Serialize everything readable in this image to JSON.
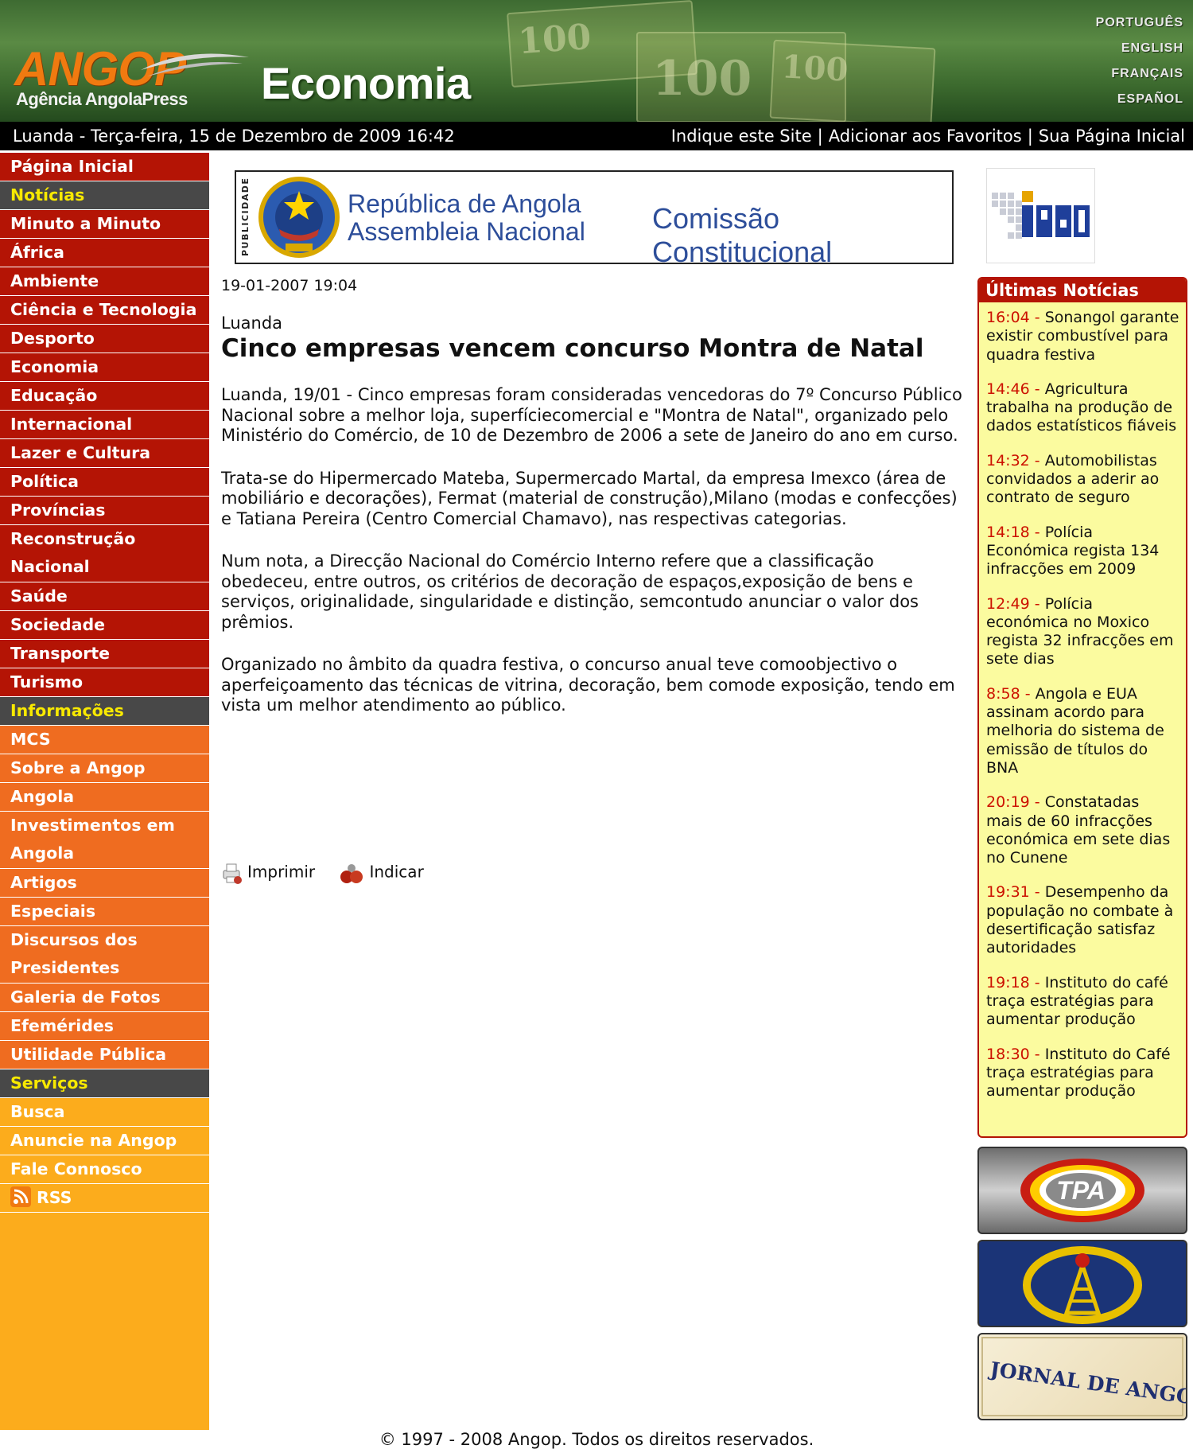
{
  "header": {
    "logo_word": "ANGOP",
    "logo_tagline": "Agência AngolaPress",
    "section": "Economia",
    "languages": [
      "PORTUGUÊS",
      "ENGLISH",
      "FRANÇAIS",
      "ESPAÑOL"
    ]
  },
  "topbar": {
    "date": "Luanda - Terça-feira, 15 de Dezembro de 2009 16:42",
    "links": [
      "Indique este Site",
      "Adicionar aos Favoritos",
      "Sua Página Inicial"
    ]
  },
  "nav": [
    {
      "label": "Página Inicial",
      "kind": "red"
    },
    {
      "label": "Notícias",
      "kind": "head"
    },
    {
      "label": "Minuto a Minuto",
      "kind": "red"
    },
    {
      "label": "África",
      "kind": "red"
    },
    {
      "label": "Ambiente",
      "kind": "red"
    },
    {
      "label": "Ciência e Tecnologia",
      "kind": "red"
    },
    {
      "label": "Desporto",
      "kind": "red"
    },
    {
      "label": "Economia",
      "kind": "red"
    },
    {
      "label": "Educação",
      "kind": "red"
    },
    {
      "label": "Internacional",
      "kind": "red"
    },
    {
      "label": "Lazer e Cultura",
      "kind": "red"
    },
    {
      "label": "Política",
      "kind": "red"
    },
    {
      "label": "Províncias",
      "kind": "red"
    },
    {
      "label": "Reconstrução Nacional",
      "kind": "red",
      "tall": true
    },
    {
      "label": "Saúde",
      "kind": "red"
    },
    {
      "label": "Sociedade",
      "kind": "red"
    },
    {
      "label": "Transporte",
      "kind": "red"
    },
    {
      "label": "Turismo",
      "kind": "red"
    },
    {
      "label": "Informações",
      "kind": "head"
    },
    {
      "label": "MCS",
      "kind": "orange"
    },
    {
      "label": "Sobre a Angop",
      "kind": "orange"
    },
    {
      "label": "Angola",
      "kind": "orange"
    },
    {
      "label": "Investimentos em Angola",
      "kind": "orange",
      "tall": true
    },
    {
      "label": "Artigos",
      "kind": "orange"
    },
    {
      "label": "Especiais",
      "kind": "orange"
    },
    {
      "label": "Discursos dos Presidentes",
      "kind": "orange",
      "tall": true
    },
    {
      "label": "Galeria de Fotos",
      "kind": "orange"
    },
    {
      "label": "Efemérides",
      "kind": "orange"
    },
    {
      "label": "Utilidade Pública",
      "kind": "orange"
    },
    {
      "label": "Serviços",
      "kind": "head"
    },
    {
      "label": "Busca",
      "kind": "yellow"
    },
    {
      "label": "Anuncie na Angop",
      "kind": "yellow"
    },
    {
      "label": "Fale Connosco",
      "kind": "yellow"
    },
    {
      "label": "RSS",
      "kind": "yellow",
      "icon": "rss-icon"
    }
  ],
  "banner": {
    "vertical_label": "PUBLICIDADE",
    "line1": "República de Angola",
    "line2": "Assembleia Nacional",
    "line3": "Comissão Constitucional"
  },
  "ipad_logo": "iPAD",
  "article": {
    "datetime": "19-01-2007 19:04",
    "place": "Luanda",
    "title": "Cinco empresas vencem concurso Montra de Natal",
    "paragraphs": [
      "Luanda, 19/01 - Cinco empresas foram consideradas vencedoras do 7º Concurso Público Nacional sobre a melhor loja, superfíciecomercial e \"Montra de Natal\", organizado pelo Ministério do Comércio, de 10 de Dezembro de 2006 a sete de Janeiro do ano em curso.",
      "Trata-se do Hipermercado Mateba, Supermercado Martal, da empresa Imexco (área de mobiliário e decorações), Fermat (material de construção),Milano (modas e confecções) e Tatiana Pereira (Centro Comercial Chamavo), nas respectivas categorias.",
      "Num nota, a Direcção Nacional do Comércio Interno refere que a classificação obedeceu, entre outros, os critérios de decoração de espaços,exposição de bens e serviços, originalidade, singularidade e distinção, semcontudo anunciar o valor dos prêmios.",
      "Organizado no âmbito da quadra festiva, o concurso anual teve comoobjectivo o aperfeiçoamento das técnicas de vitrina, decoração, bem comode exposição, tendo em vista um melhor atendimento ao público."
    ],
    "actions": {
      "print": "Imprimir",
      "recommend": "Indicar"
    }
  },
  "latest": {
    "heading": "Últimas Notícias",
    "items": [
      {
        "time": "16:04 -",
        "text": "Sonangol garante existir combustível para quadra festiva"
      },
      {
        "time": "14:46 -",
        "text": "Agricultura trabalha na produção de dados estatísticos fiáveis"
      },
      {
        "time": "14:32 -",
        "text": "Automobilistas convidados a aderir ao contrato de seguro"
      },
      {
        "time": "14:18 -",
        "text": "Polícia Económica regista 134 infracções em 2009"
      },
      {
        "time": "12:49 -",
        "text": "Polícia económica no Moxico regista 32 infracções em sete dias"
      },
      {
        "time": "8:58 -",
        "text": "Angola e EUA assinam acordo para melhoria do sistema de emissão de títulos do BNA"
      },
      {
        "time": "20:19 -",
        "text": "Constatadas mais de 60 infracções económica em sete dias no Cunene"
      },
      {
        "time": "19:31 -",
        "text": "Desempenho da população no combate à desertificação satisfaz autoridades"
      },
      {
        "time": "19:18 -",
        "text": "Instituto do café traça estratégias para aumentar produção"
      },
      {
        "time": "18:30 -",
        "text": "Instituto do Café traça estratégias para aumentar produção"
      }
    ]
  },
  "side_logos": {
    "tpa": "TPA",
    "jornal": "JORNAL DE ANGOLA"
  },
  "footer": "© 1997 - 2008 Angop. Todos os direitos reservados.",
  "colors": {
    "nav_red": "#b41405",
    "nav_head": "#484848",
    "nav_head_text": "#f8e900",
    "nav_orange": "#ef6c20",
    "nav_yellow": "#fcac1c",
    "news_bg": "#fbfb9f",
    "news_time": "#cc1100",
    "banner_blue": "#2d4e9a"
  }
}
